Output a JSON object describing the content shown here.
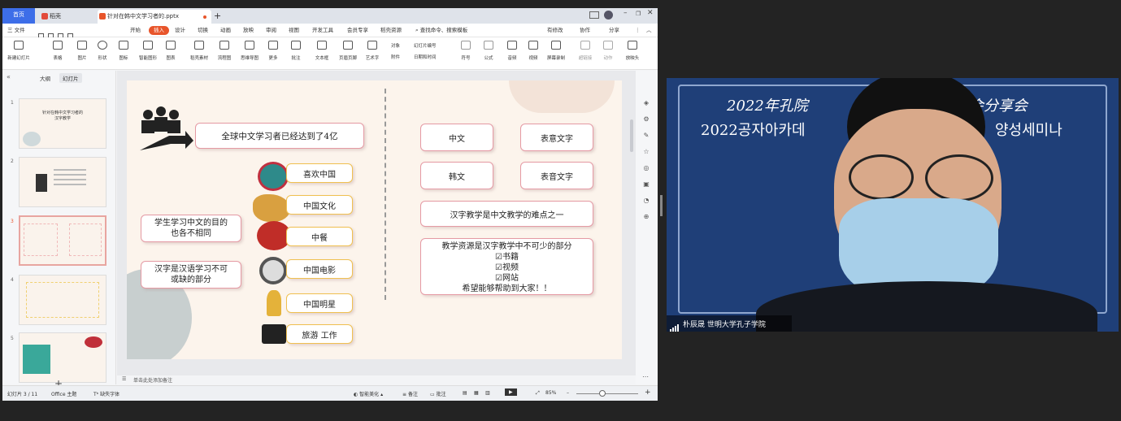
{
  "tabs": {
    "home": "首页",
    "docer": "稻壳",
    "file": "针对在韩中文学习者的.pptx"
  },
  "menu": [
    "三 文件",
    "开始",
    "插入",
    "设计",
    "切换",
    "动画",
    "放映",
    "审阅",
    "视图",
    "开发工具",
    "会员专享",
    "稻壳资源"
  ],
  "menu_search": "查找命令、搜索模板",
  "menu_right": {
    "edit": "有修改",
    "collab": "协作",
    "share": "分享"
  },
  "ribbon": [
    "新建幻灯片",
    "表格",
    "图片",
    "形状",
    "图标",
    "智能图形",
    "图表",
    "稻壳素材",
    "流程图",
    "思维导图",
    "更多",
    "批注",
    "文本框",
    "页眉页脚",
    "艺术字",
    "符号",
    "公式",
    "音频",
    "视频",
    "屏幕录制",
    "超链接",
    "动作",
    "放映头"
  ],
  "ribbon_small": {
    "obj": "对象",
    "num": "幻灯片编号",
    "attach": "附件",
    "date": "日期和时间"
  },
  "panel_tabs": {
    "outline": "大纲",
    "slides": "幻灯片"
  },
  "thumb1_title": "针对在韩中文学习者的\n汉字教学",
  "slide": {
    "banner": "全球中文学习者已经达到了4亿",
    "left1": "学生学习中文的目的\n也各不相同",
    "left2": "汉字是汉语学习不可\n或缺的部分",
    "items": [
      "喜欢中国",
      "中国文化",
      "中餐",
      "中国电影",
      "中国明星",
      "旅游  工作"
    ],
    "r1": "中文",
    "r2": "表意文字",
    "r3": "韩文",
    "r4": "表音文字",
    "r5": "汉字教学是中文教学的难点之一",
    "r6": {
      "title": "教学资源是汉字教学中不可少的部分",
      "c1": "☑书籍",
      "c2": "☑视频",
      "c3": "☑网站",
      "end": "希望能够帮助到大家！！"
    }
  },
  "notes": "单击此处添加备注",
  "status": {
    "slide": "幻灯片 3 / 11",
    "theme": "Office 主题",
    "font": "缺失字体",
    "beautify": "智能美化",
    "remark": "备注",
    "comment": "批注",
    "zoom": "85%"
  },
  "video": {
    "line1": "2022年孔院",
    "line1b": "会分享会",
    "line2": "2022공자아카데",
    "line2b": "양성세미나",
    "name": "朴辰晟 世明大学孔子学院"
  },
  "colors": {
    "accent": "#e8552b",
    "home_tab": "#3d6ee8",
    "box_border": "#e59aa4",
    "video_bg": "#1f3f78"
  }
}
